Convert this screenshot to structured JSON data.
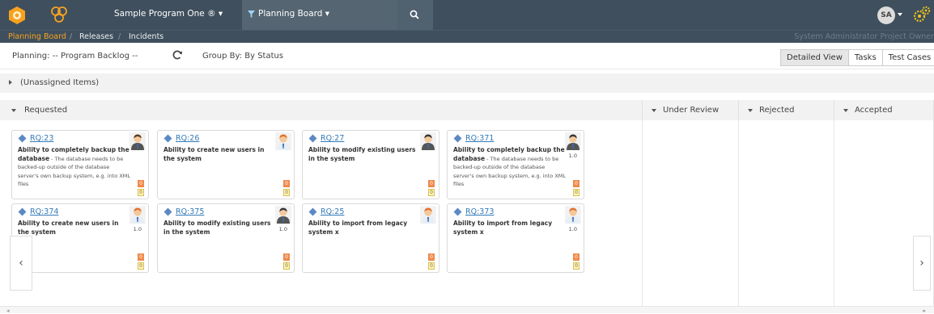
{
  "topbar": {
    "program_name": "Sample Program One ® ▾",
    "board_label": "Planning Board ▾",
    "avatar_initials": "SA"
  },
  "breadcrumb": {
    "active": "Planning Board",
    "sep": "/",
    "releases": "Releases",
    "incidents": "Incidents",
    "user_info": "System Administrator  Project Owner"
  },
  "toolbar": {
    "planning_label": "Planning:",
    "planning_value": "-- Program Backlog --",
    "group_label": "Group By:",
    "group_value": "By Status",
    "views": [
      "Detailed View",
      "Tasks",
      "Test Cases"
    ]
  },
  "unassigned_label": "(Unassigned Items)",
  "columns": [
    "Requested",
    "Under Review",
    "Rejected",
    "Accepted"
  ],
  "colors": {
    "topbar": "#3f4f5d",
    "accent_orange": "#f7a21e",
    "link_blue": "#337ab7",
    "badge_orange": "#f0894c",
    "badge_yellow": "#fff3c4"
  },
  "cards": [
    {
      "id": "RQ:23",
      "title": "Ability to completely backup the database",
      "desc": " - The database needs to be backed-up outside of the database server's own backup system, e.g. into XML files",
      "est": "",
      "badge1": "0",
      "badge2": "0"
    },
    {
      "id": "RQ:26",
      "title": "Ability to create new users in the system",
      "desc": "",
      "est": "",
      "badge1": "0",
      "badge2": "0"
    },
    {
      "id": "RQ:27",
      "title": "Ability to modify existing users in the system",
      "desc": "",
      "est": "",
      "badge1": "0",
      "badge2": "0"
    },
    {
      "id": "RQ:371",
      "title": "Ability to completely backup the database",
      "desc": " - The database needs to be backed-up outside of the database server's own backup system, e.g. into XML files",
      "est": "1.0",
      "badge1": "0",
      "badge2": "0"
    },
    {
      "id": "RQ:374",
      "title": "Ability to create new users in the system",
      "desc": "",
      "est": "1.0",
      "badge1": "0",
      "badge2": "0"
    },
    {
      "id": "RQ:375",
      "title": "Ability to modify existing users in the system",
      "desc": "",
      "est": "1.0",
      "badge1": "0",
      "badge2": "0"
    },
    {
      "id": "RQ:25",
      "title": "Ability to import from legacy system x",
      "desc": "",
      "est": "",
      "badge1": "0",
      "badge2": "0"
    },
    {
      "id": "RQ:373",
      "title": "Ability to import from legacy system x",
      "desc": "",
      "est": "1.0",
      "badge1": "0",
      "badge2": "0"
    }
  ],
  "nav": {
    "prev": "‹",
    "next": "›"
  },
  "scroll": {
    "left": "◂",
    "right": "▸"
  }
}
